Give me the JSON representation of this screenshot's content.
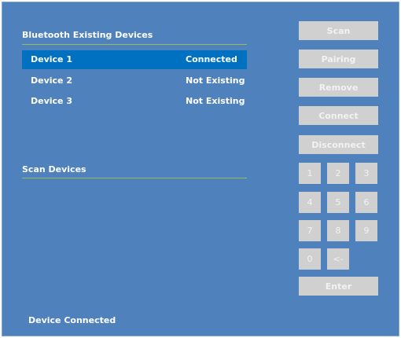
{
  "existing": {
    "title": "Bluetooth Existing Devices",
    "devices": [
      {
        "name": "Device 1",
        "status": "Connected",
        "selected": true
      },
      {
        "name": "Device 2",
        "status": "Not Existing",
        "selected": false
      },
      {
        "name": "Device 3",
        "status": "Not Existing",
        "selected": false
      }
    ]
  },
  "scan": {
    "title": "Scan Devices"
  },
  "buttons": {
    "scan": "Scan",
    "pairing": "Pairing",
    "remove": "Remove",
    "connect": "Connect",
    "disconnect": "Disconnect",
    "enter": "Enter"
  },
  "keypad": [
    "1",
    "2",
    "3",
    "4",
    "5",
    "6",
    "7",
    "8",
    "9",
    "0",
    "<-"
  ],
  "status": "Device Connected",
  "colors": {
    "background": "#4f81bd",
    "selected_row": "#0070c0",
    "divider": "#9bbb59",
    "button": "#d0d0d0"
  }
}
